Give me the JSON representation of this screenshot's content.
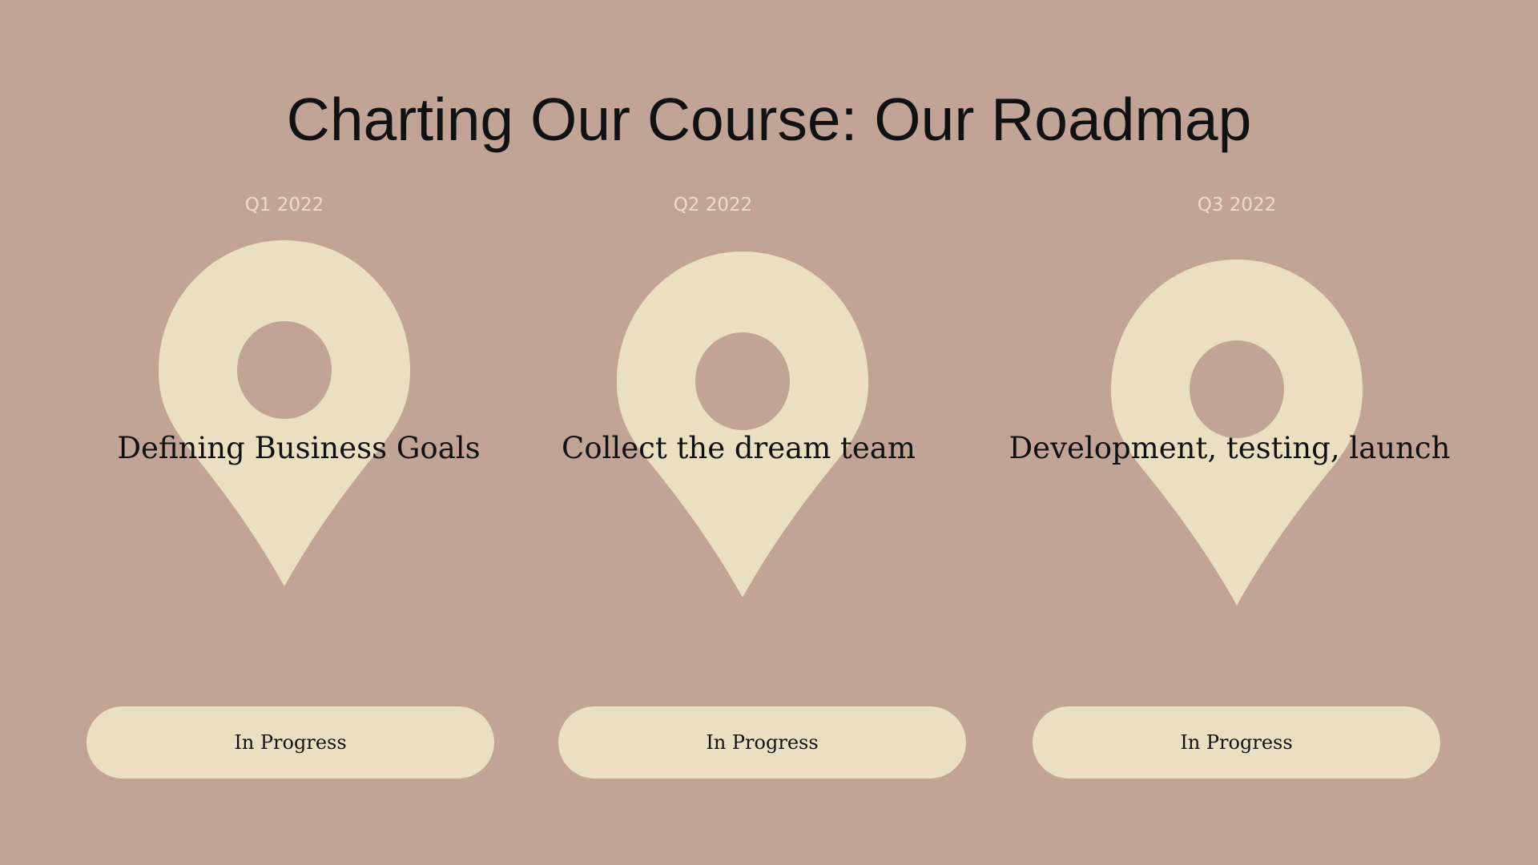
{
  "slide": {
    "title": "Charting Our Course: Our Roadmap",
    "colors": {
      "background": "#c2a497",
      "accent": "#eadfc0",
      "text": "#111111"
    }
  },
  "milestones": [
    {
      "quarter": "Q1 2022",
      "label": "Defining Business Goals",
      "status": "In Progress",
      "icon": "map-pin-icon"
    },
    {
      "quarter": "Q2 2022",
      "label": "Collect the dream team",
      "status": "In Progress",
      "icon": "map-pin-icon"
    },
    {
      "quarter": "Q3 2022",
      "label": "Development, testing, launch",
      "status": "In Progress",
      "icon": "map-pin-icon"
    }
  ]
}
